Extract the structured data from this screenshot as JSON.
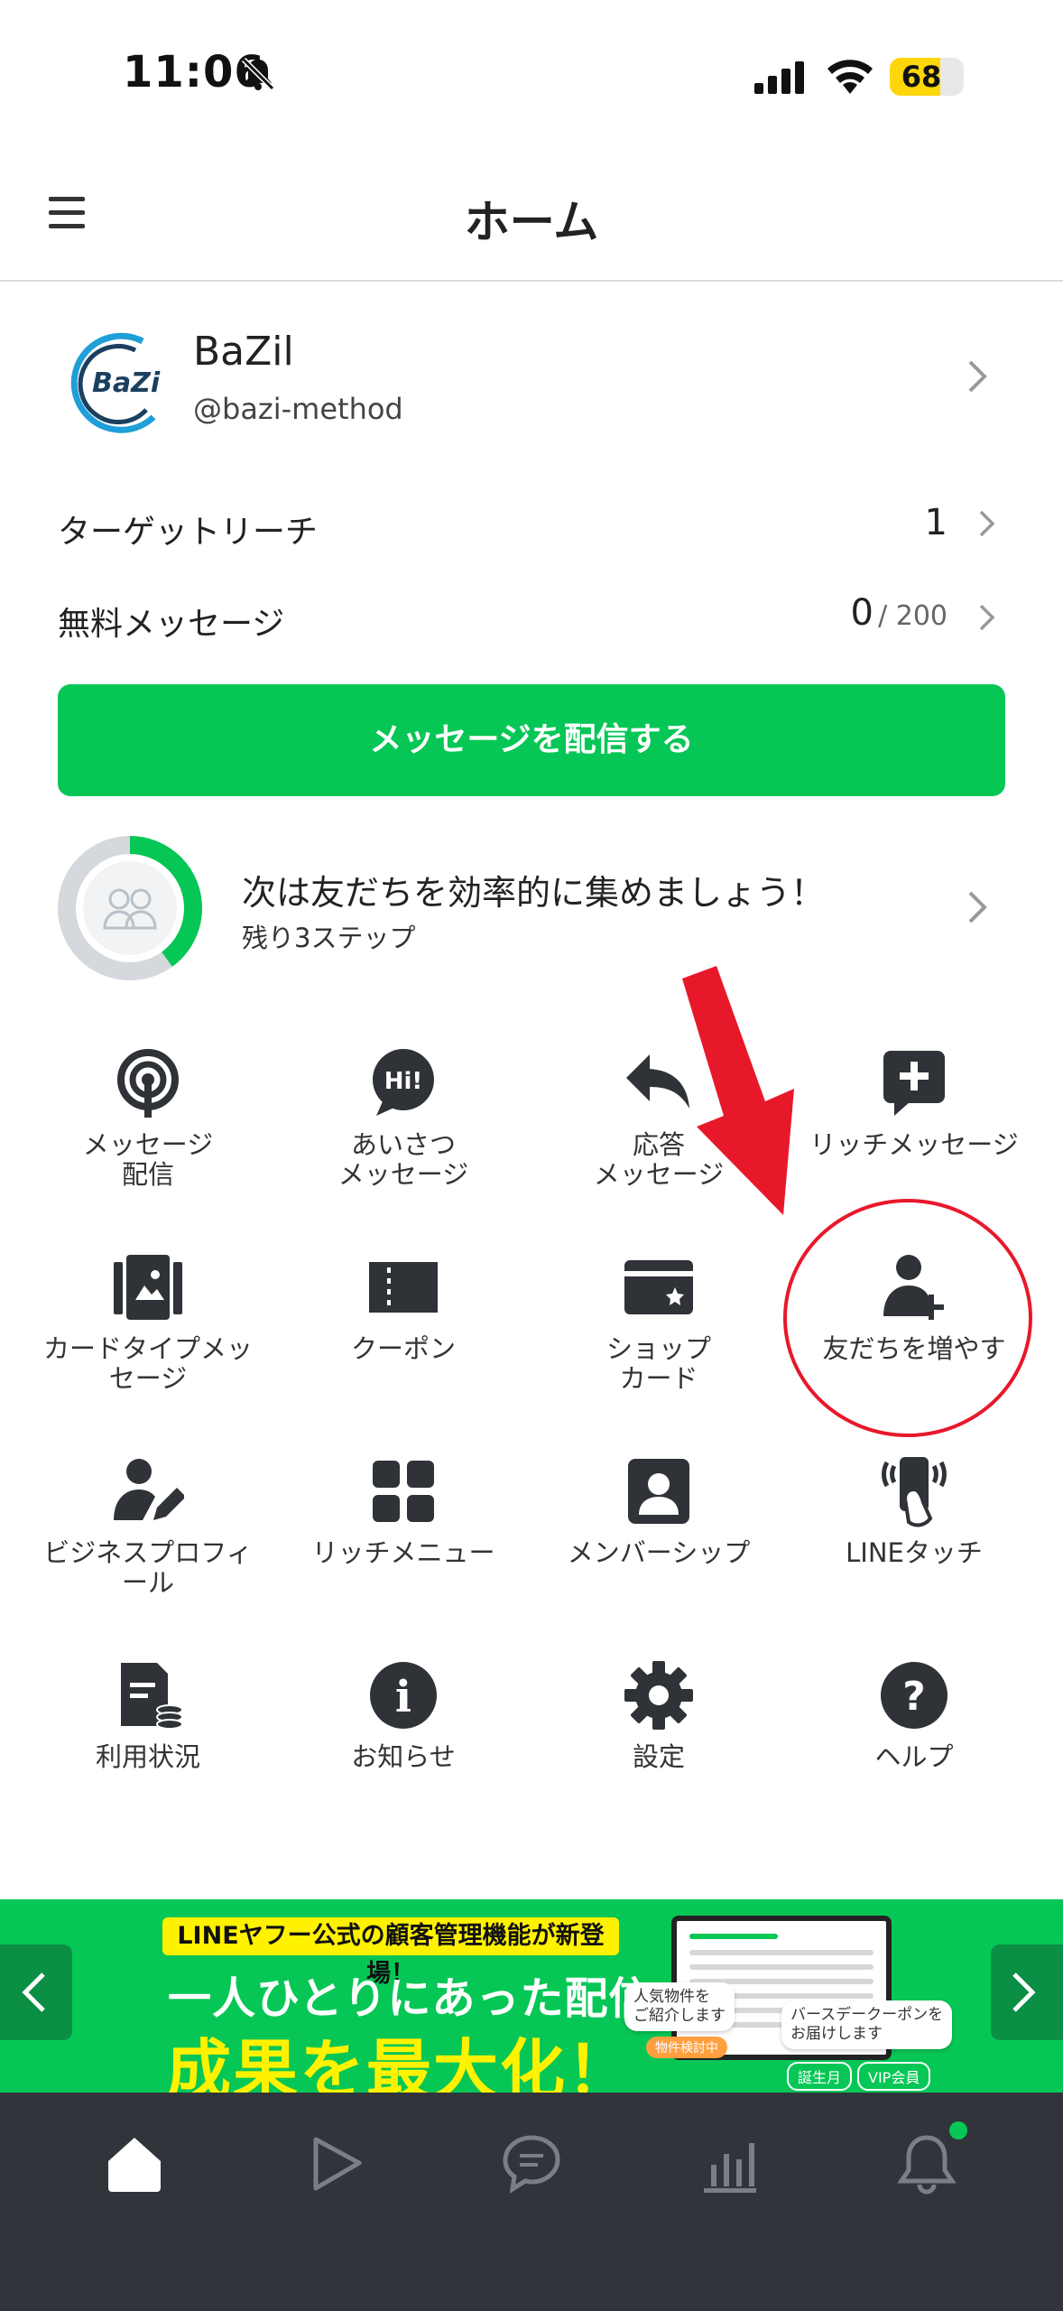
{
  "status_bar": {
    "time": "11:06",
    "battery": "68",
    "battery_level": 0.68
  },
  "header": {
    "title": "ホーム"
  },
  "account": {
    "logo_text": "BaZi",
    "name": "BaZil",
    "id": "@bazi-method"
  },
  "stats": {
    "target_reach_label": "ターゲットリーチ",
    "target_reach_value": "1",
    "free_messages_label": "無料メッセージ",
    "free_messages_value": "0",
    "free_messages_total": "/ 200"
  },
  "cta": {
    "label": "メッセージを配信する"
  },
  "onboarding": {
    "title": "次は友だちを効率的に集めましょう！",
    "subtitle": "残り3ステップ",
    "progress": 0.4
  },
  "menu": [
    {
      "label": "メッセージ\n配信",
      "icon": "broadcast-icon"
    },
    {
      "label": "あいさつ\nメッセージ",
      "icon": "hi-bubble-icon",
      "icon_text": "Hi!"
    },
    {
      "label": "応答\nメッセージ",
      "icon": "reply-arrow-icon"
    },
    {
      "label": "リッチメッセージ",
      "icon": "plus-bubble-icon"
    },
    {
      "label": "カードタイプメッ\nセージ",
      "icon": "card-type-icon"
    },
    {
      "label": "クーポン",
      "icon": "coupon-icon"
    },
    {
      "label": "ショップ\nカード",
      "icon": "shop-card-icon"
    },
    {
      "label": "友だちを増やす",
      "icon": "add-friend-icon"
    },
    {
      "label": "ビジネスプロフィ\nール",
      "icon": "business-profile-icon"
    },
    {
      "label": "リッチメニュー",
      "icon": "rich-menu-icon"
    },
    {
      "label": "メンバーシップ",
      "icon": "membership-icon"
    },
    {
      "label": "LINEタッチ",
      "icon": "line-touch-icon"
    },
    {
      "label": "利用状況",
      "icon": "usage-icon"
    },
    {
      "label": "お知らせ",
      "icon": "info-icon",
      "icon_text": "i"
    },
    {
      "label": "設定",
      "icon": "gear-icon"
    },
    {
      "label": "ヘルプ",
      "icon": "help-icon",
      "icon_text": "?"
    }
  ],
  "banner": {
    "strip": "LINEヤフー公式の顧客管理機能が新登場！",
    "line1": "一人ひとりにあった配信で",
    "line2": "成果を最大化！",
    "bubble1": "人気物件を\nご紹介します",
    "bubble1_tag": "物件検討中",
    "bubble2": "バースデークーポンを\nお届けします",
    "tag1": "誕生月",
    "tag2": "VIP会員",
    "colors": {
      "background": "#06c755",
      "highlight": "#fff200"
    }
  },
  "tabs": [
    "home-tab",
    "play-tab",
    "chat-tab",
    "analytics-tab",
    "notifications-tab"
  ],
  "colors": {
    "accent": "#06c755",
    "annotation": "#e8182b",
    "tabbar": "#31353b"
  }
}
